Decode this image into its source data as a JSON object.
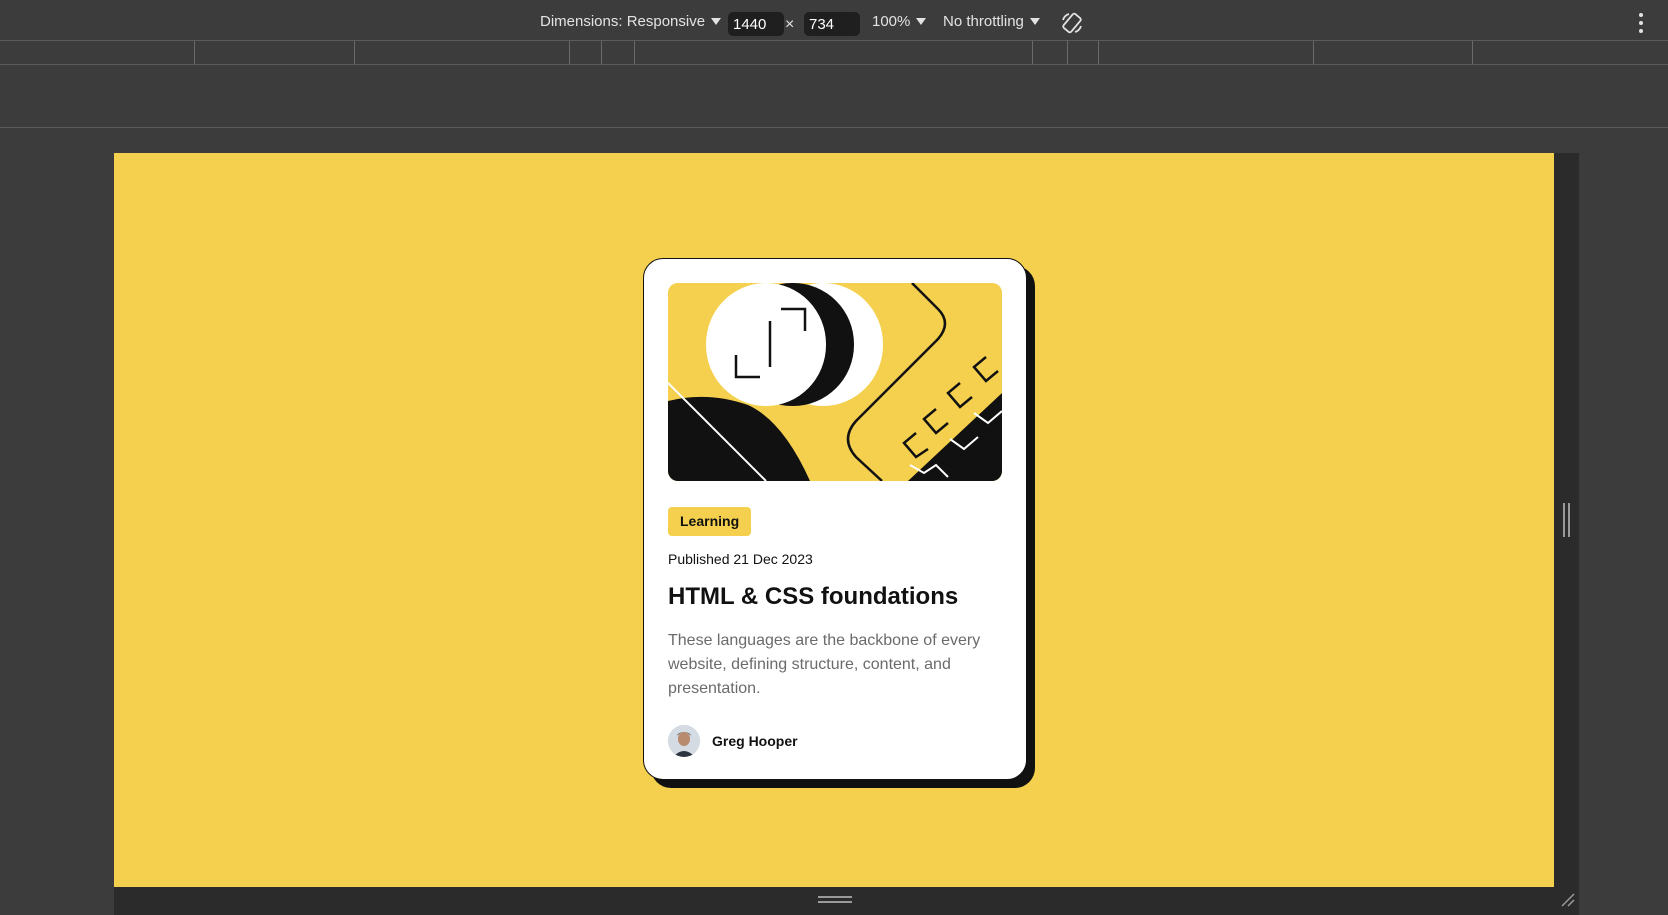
{
  "toolbar": {
    "dimensions_label": "Dimensions: Responsive",
    "width_value": "1440",
    "height_value": "734",
    "times": "×",
    "zoom": "100%",
    "throttling": "No throttling"
  },
  "card": {
    "tag": "Learning",
    "published": "Published 21 Dec 2023",
    "title": "HTML & CSS foundations",
    "description": "These languages are the backbone of every website, defining structure, content, and presentation.",
    "author": "Greg Hooper"
  },
  "colors": {
    "page_bg": "#f4d04e",
    "devtools_bg": "#3c3c3c",
    "card_bg": "#ffffff",
    "ink": "#111111",
    "muted": "#6b6b6b"
  },
  "icons": [
    "dropdown-arrow-icon",
    "rotate-device-icon",
    "more-options-icon",
    "resize-handle-icon"
  ]
}
